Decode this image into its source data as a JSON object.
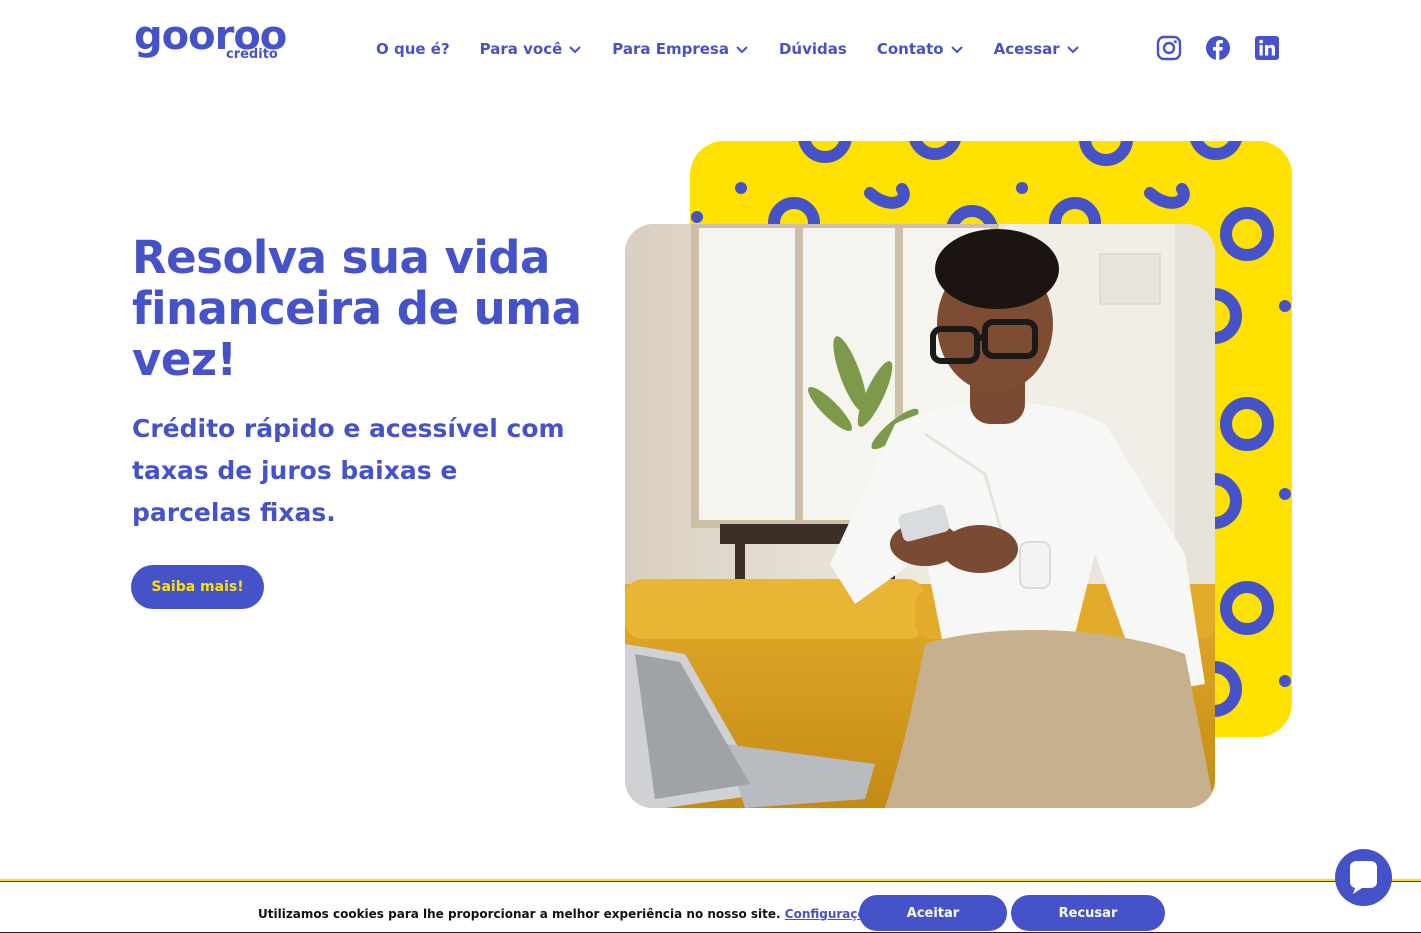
{
  "brand": {
    "name": "gooroo",
    "sub": "crédito",
    "primary_color": "#4652c8",
    "accent_color": "#ffe100"
  },
  "nav": {
    "items": [
      {
        "label": "O que é?",
        "dropdown": false
      },
      {
        "label": "Para você",
        "dropdown": true
      },
      {
        "label": "Para Empresa",
        "dropdown": true
      },
      {
        "label": "Dúvidas",
        "dropdown": false
      },
      {
        "label": "Contato",
        "dropdown": true
      },
      {
        "label": "Acessar",
        "dropdown": true
      }
    ]
  },
  "socials": [
    "instagram-icon",
    "facebook-icon",
    "linkedin-icon"
  ],
  "hero": {
    "title": "Resolva sua vida financeira de uma vez!",
    "subtitle": "Crédito rápido e acessível com taxas de juros baixas e parcelas fixas.",
    "cta_label": "Saiba mais!"
  },
  "cookie": {
    "text": "Utilizamos cookies para lhe proporcionar a melhor experiência no nosso site.",
    "link_label": "Configurações",
    "accept_label": "Aceitar",
    "reject_label": "Recusar"
  },
  "chat": {
    "icon": "chat-bubble-icon"
  }
}
